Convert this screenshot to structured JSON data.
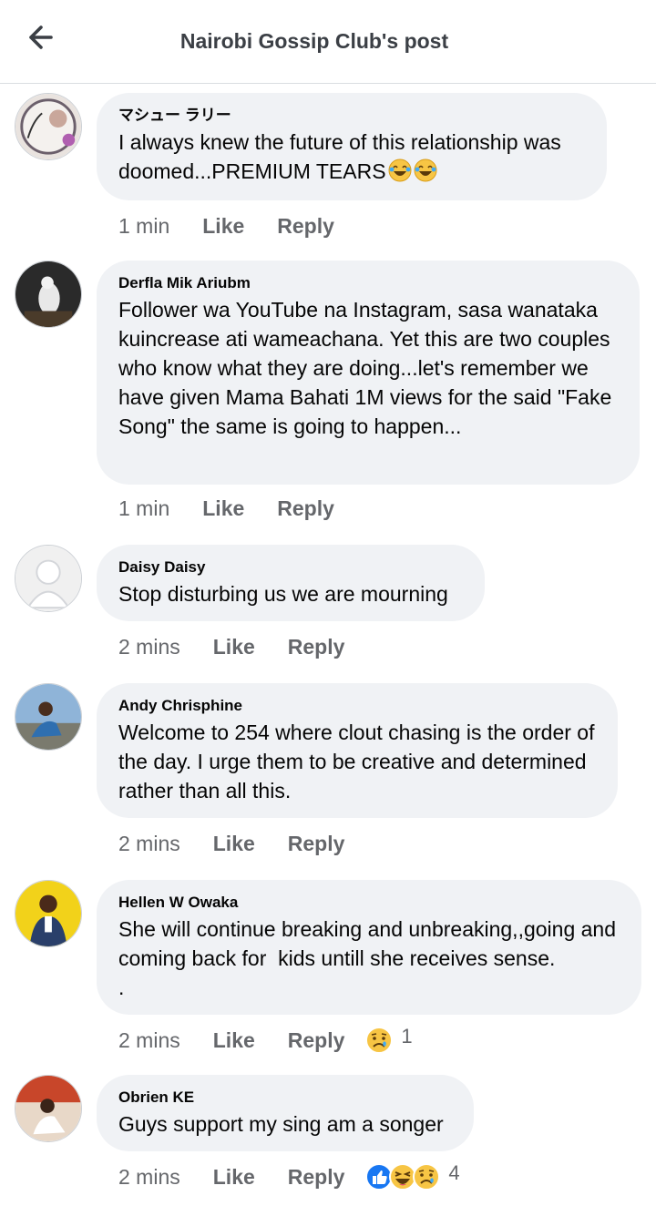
{
  "header": {
    "title": "Nairobi Gossip Club's post",
    "back_icon": "back-arrow-icon"
  },
  "labels": {
    "like": "Like",
    "reply": "Reply"
  },
  "colors": {
    "meta_gray": "#65676b",
    "bubble_bg": "#f0f2f5",
    "like_blue": "#1877f2",
    "emoji_yellow": "#f7c544"
  },
  "comments": [
    {
      "author": "マシュー ラリー",
      "text": "I always knew the future of this relationship was doomed...PREMIUM TEARS",
      "emoji": [
        "laughing-tears-icon",
        "laughing-tears-icon"
      ],
      "time": "1 min"
    },
    {
      "author": "Derfla Mik Ariubm",
      "text": "Follower wa YouTube na Instagram, sasa wanataka kuincrease ati wameachana. Yet this are two couples who know what they are doing...let's remember we have given Mama Bahati 1M views for the said \"Fake Song\" the same is going to happen...",
      "time": "1 min"
    },
    {
      "author": "Daisy Daisy",
      "text": "Stop disturbing us we are mourning",
      "time": "2 mins"
    },
    {
      "author": "Andy Chrisphine",
      "text": "Welcome to 254 where clout chasing is the order of the day. I urge them to be creative and determined rather than all this.",
      "time": "2 mins"
    },
    {
      "author": "Hellen W Owaka",
      "text": "She will continue breaking and unbreaking,,going and coming back for  kids untill she receives sense.\n.",
      "time": "2 mins",
      "reactions": {
        "icons": [
          "sad-reaction-icon"
        ],
        "count": "1"
      }
    },
    {
      "author": "Obrien KE",
      "text": "Guys support my sing am a songer",
      "time": "2 mins",
      "reactions": {
        "icons": [
          "like-reaction-icon",
          "haha-reaction-icon",
          "sad-reaction-icon"
        ],
        "count": "4"
      }
    }
  ]
}
